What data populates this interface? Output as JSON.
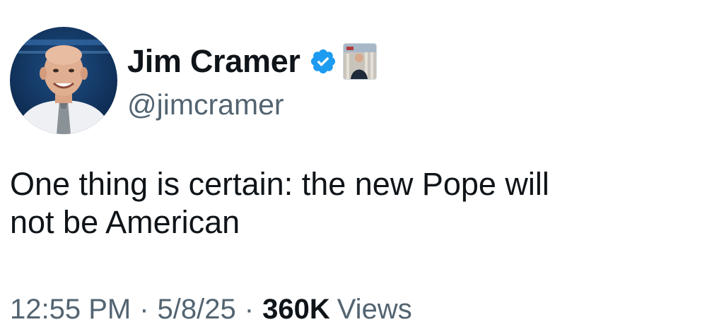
{
  "author": {
    "display_name": "Jim Cramer",
    "handle": "@jimcramer",
    "verified": true,
    "verified_icon": "verified-badge-icon",
    "verified_color": "#1d9bf0",
    "affiliation_icon": "affiliation-badge-icon"
  },
  "tweet": {
    "text": "One thing is certain: the new Pope will\nnot be American"
  },
  "meta": {
    "time": "12:55 PM",
    "separator": "·",
    "date": "5/8/25",
    "views_count": "360K",
    "views_label": "Views"
  },
  "colors": {
    "text_primary": "#0f1419",
    "text_secondary": "#536471",
    "background": "#ffffff"
  }
}
